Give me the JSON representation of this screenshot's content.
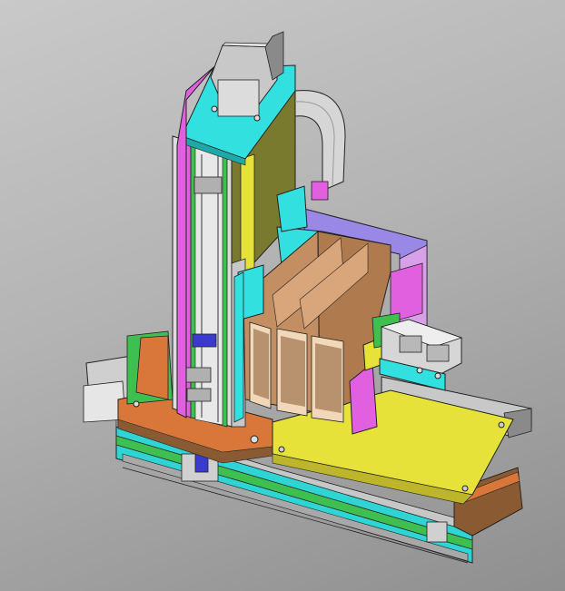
{
  "viewport": {
    "background_top": "#c9c9c9",
    "background_bottom": "#8f8f8f"
  },
  "colors": {
    "cyan": "#33e0e0",
    "magenta": "#e060e0",
    "orange": "#d9773a",
    "yellow": "#e6e23a",
    "olive": "#7a7a2e",
    "green": "#3fbf4f",
    "gray_metal": "#c8c8c8",
    "dark_gray": "#6e6e6e",
    "wood": "#c28e62",
    "wood_dark": "#8a5a33",
    "lavender": "#9a88e6",
    "blue": "#3a3ad0",
    "brown": "#6b3a1e"
  },
  "parts": [
    "stepper-motor",
    "vertical-column",
    "linear-rail",
    "motor-cable",
    "card-cassette",
    "base-plate",
    "slide-carriage",
    "gripper-module",
    "horizontal-stage"
  ]
}
